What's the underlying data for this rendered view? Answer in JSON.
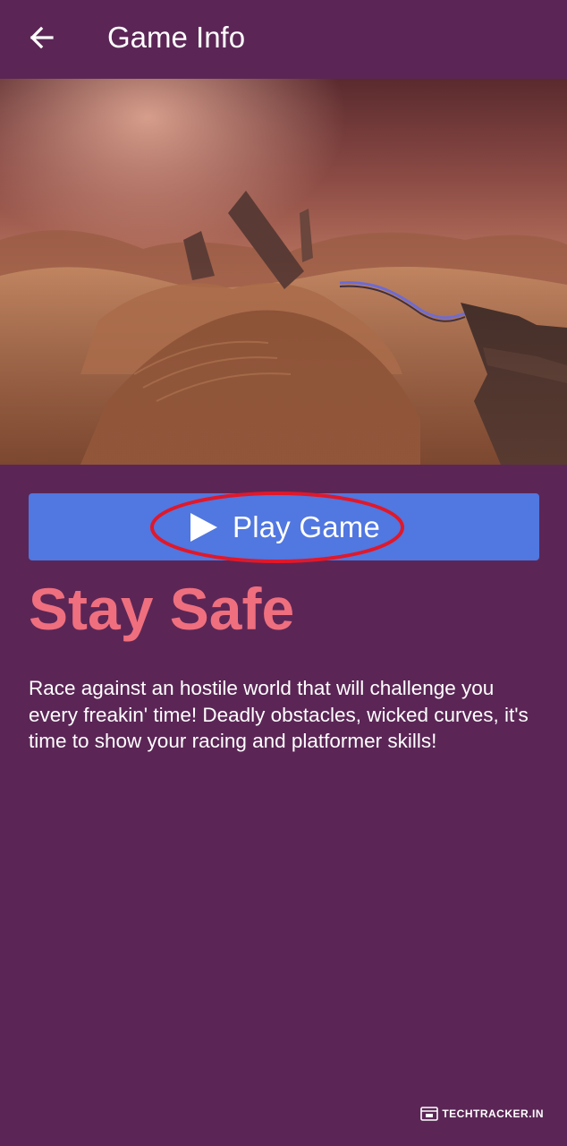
{
  "app_bar": {
    "title": "Game Info",
    "back_icon": "arrow-left-icon"
  },
  "hero": {
    "image_subject": "desert racing game scene at dusk"
  },
  "play_button": {
    "label": "Play Game",
    "icon": "play-icon",
    "highlight_color": "#e0182a"
  },
  "game": {
    "title": "Stay Safe",
    "description": "Race against an hostile world that will challenge you every freakin' time! Deadly obstacles, wicked curves, it's time to show your racing and platformer skills!"
  },
  "watermark": {
    "text": "TECHTRACKER.IN",
    "icon": "browser-window-icon"
  },
  "colors": {
    "background": "#5b2656",
    "button": "#5177e0",
    "title": "#ef6f7f",
    "text": "#ffffff"
  }
}
